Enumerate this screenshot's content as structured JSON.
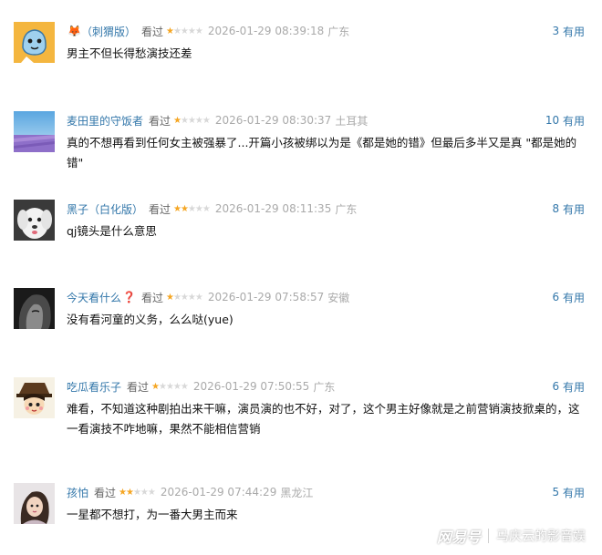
{
  "comments": [
    {
      "user": "（刺猬版）",
      "user_prefix_icon": "fox-icon",
      "status": "看过",
      "rating": 1,
      "time": "2026-01-29 08:39:18",
      "location": "广东",
      "useful_count": "3",
      "useful_label": "有用",
      "text": "男主不但长得愁演技还差"
    },
    {
      "user": "麦田里的守饭者",
      "status": "看过",
      "rating": 1,
      "time": "2026-01-29 08:30:37",
      "location": "土耳其",
      "useful_count": "10",
      "useful_label": "有用",
      "text": "真的不想再看到任何女主被强暴了...开篇小孩被绑以为是《都是她的错》但最后多半又是真 \"都是她的错\""
    },
    {
      "user": "黑子（白化版）",
      "status": "看过",
      "rating": 2,
      "time": "2026-01-29 08:11:35",
      "location": "广东",
      "useful_count": "8",
      "useful_label": "有用",
      "text": "qj镜头是什么意思"
    },
    {
      "user": "今天看什么",
      "user_suffix_icon": "question-mark-icon",
      "status": "看过",
      "rating": 1,
      "time": "2026-01-29 07:58:57",
      "location": "安徽",
      "useful_count": "6",
      "useful_label": "有用",
      "text": "没有看河童的义务，么么哒(yue)"
    },
    {
      "user": "吃瓜看乐子",
      "status": "看过",
      "rating": 1,
      "time": "2026-01-29 07:50:55",
      "location": "广东",
      "useful_count": "6",
      "useful_label": "有用",
      "text": "难看，不知道这种剧拍出来干嘛，演员演的也不好，对了，这个男主好像就是之前营销演技掀桌的，这一看演技不咋地嘛，果然不能相信营销"
    },
    {
      "user": "孩怕",
      "status": "看过",
      "rating": 2,
      "time": "2026-01-29 07:44:29",
      "location": "黑龙江",
      "useful_count": "5",
      "useful_label": "有用",
      "text": "一星都不想打，为一番大男主而来"
    }
  ],
  "watermark": {
    "brand": "网易号",
    "author": "马庆云的影音娱"
  },
  "colors": {
    "username": "#3377aa",
    "star_on": "#f5a623",
    "star_off": "#d8d8d8",
    "meta_gray": "#aaaaaa",
    "text": "#111111"
  }
}
